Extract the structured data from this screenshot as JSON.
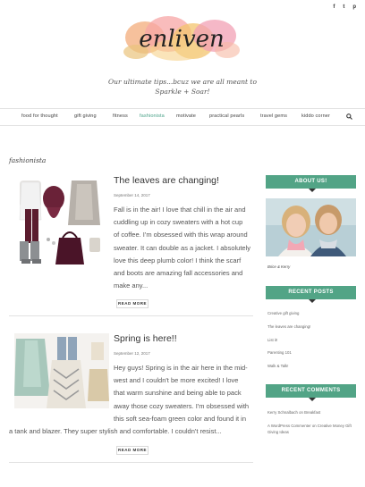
{
  "header": {
    "social": [
      {
        "name": "facebook-icon",
        "glyph": "f"
      },
      {
        "name": "twitter-icon",
        "glyph": "t"
      },
      {
        "name": "pinterest-icon",
        "glyph": "p"
      }
    ],
    "logo_text": "enliven",
    "tagline_line1": "Our ultimate tips...bcuz we are all meant to",
    "tagline_line2": "Sparkle + Soar!"
  },
  "nav": {
    "items": [
      {
        "label": "food for thought"
      },
      {
        "label": "gift giving"
      },
      {
        "label": "fitness"
      },
      {
        "label": "fashionista"
      },
      {
        "label": "motivate"
      },
      {
        "label": "practical pearls"
      },
      {
        "label": "travel gems"
      },
      {
        "label": "kiddo corner"
      }
    ],
    "active_index": 3
  },
  "page_label": "fashionista",
  "posts": [
    {
      "title": "The leaves are changing!",
      "date": "September 14, 2017",
      "body_lines": [
        "Fall is in the air! I love that chill in the air and",
        "cuddling up in cozy sweaters with a hot cup",
        "of coffee. I'm obsessed with this wrap around",
        "sweater. It can double as a jacket. I absolutely",
        "love this deep plumb color! I think the scarf",
        "and boots are amazing fall accessories and",
        "make any..."
      ],
      "read_more": "READ MORE"
    },
    {
      "title": "Spring is here!!",
      "date": "September 12, 2017",
      "body_lines": [
        "Hey guys! Spring is in the air here in the mid-",
        "west and I couldn't be more excited! I love",
        "that warm sunshine and being able to pack",
        "away those cozy sweaters. I'm obsessed with",
        "this soft sea-foam green color and found it in",
        "a tank and blazer. They super stylish and comfortable. I couldn't resist..."
      ],
      "read_more": "READ MORE"
    }
  ],
  "sidebar": {
    "about_title": "ABOUT US!",
    "about_caption": "Brice & Kerry",
    "recent_posts_title": "RECENT POSTS",
    "recent_posts": [
      "Creative gift giving",
      "The leaves are changing!",
      "List it!",
      "Parenting 101",
      "Walk & Talk!"
    ],
    "recent_comments_title": "RECENT COMMENTS",
    "comments": [
      "Kerry Schnalbach on Breakfast",
      "A WordPress Commenter on Creative Money Gift Giving Ideas"
    ]
  },
  "colors": {
    "accent": "#52a486",
    "nav_active": "#4aa288"
  }
}
